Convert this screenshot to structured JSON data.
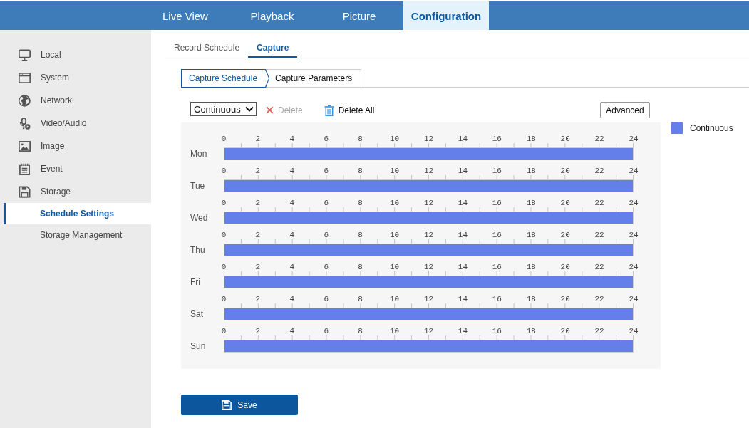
{
  "top_nav": [
    {
      "label": "Live View",
      "selected": false
    },
    {
      "label": "Playback",
      "selected": false
    },
    {
      "label": "Picture",
      "selected": false
    },
    {
      "label": "Configuration",
      "selected": true
    }
  ],
  "sidebar": {
    "items": [
      {
        "label": "Local",
        "selected": false
      },
      {
        "label": "System",
        "selected": false
      },
      {
        "label": "Network",
        "selected": false
      },
      {
        "label": "Video/Audio",
        "selected": false
      },
      {
        "label": "Image",
        "selected": false
      },
      {
        "label": "Event",
        "selected": false
      },
      {
        "label": "Storage",
        "selected": false,
        "children": [
          {
            "label": "Schedule Settings",
            "selected": true
          },
          {
            "label": "Storage Management",
            "selected": false
          }
        ]
      }
    ]
  },
  "tabs": [
    {
      "label": "Record Schedule",
      "selected": false
    },
    {
      "label": "Capture",
      "selected": true
    }
  ],
  "steps": [
    {
      "label": "Capture Schedule",
      "selected": true
    },
    {
      "label": "Capture Parameters",
      "selected": false
    }
  ],
  "toolbar": {
    "mode_select": {
      "value": "Continuous"
    },
    "delete": {
      "label": "Delete",
      "disabled": true
    },
    "delete_all": {
      "label": "Delete All",
      "disabled": false
    },
    "advanced": {
      "label": "Advanced"
    }
  },
  "schedule": {
    "days": [
      {
        "label": "Mon",
        "ticks": [
          "0",
          "2",
          "4",
          "6",
          "8",
          "10",
          "12",
          "14",
          "16",
          "18",
          "20",
          "22",
          "24"
        ],
        "level": 1
      },
      {
        "label": "Tue",
        "ticks": [
          "0",
          "2",
          "4",
          "6",
          "8",
          "10",
          "12",
          "14",
          "16",
          "18",
          "20",
          "22",
          "24"
        ],
        "level": 1
      },
      {
        "label": "Wed",
        "ticks": [
          "0",
          "2",
          "4",
          "6",
          "8",
          "10",
          "12",
          "14",
          "16",
          "18",
          "20",
          "22",
          "24"
        ],
        "level": 1
      },
      {
        "label": "Thu",
        "ticks": [
          "0",
          "2",
          "4",
          "6",
          "8",
          "10",
          "12",
          "14",
          "16",
          "18",
          "20",
          "22",
          "24"
        ],
        "level": 1
      },
      {
        "label": "Fri",
        "ticks": [
          "0",
          "2",
          "4",
          "6",
          "8",
          "10",
          "12",
          "14",
          "16",
          "18",
          "20",
          "22",
          "24"
        ],
        "level": 1
      },
      {
        "label": "Sat",
        "ticks": [
          "0",
          "2",
          "4",
          "6",
          "8",
          "10",
          "12",
          "14",
          "16",
          "18",
          "20",
          "22",
          "24"
        ],
        "level": 1
      },
      {
        "label": "Sun",
        "ticks": [
          "0",
          "2",
          "4",
          "6",
          "8",
          "10",
          "12",
          "14",
          "16",
          "18",
          "20",
          "22",
          "24"
        ],
        "level": 1
      }
    ]
  },
  "legend": [
    {
      "label": "Continuous"
    }
  ],
  "save_button": {
    "label": "Save"
  }
}
